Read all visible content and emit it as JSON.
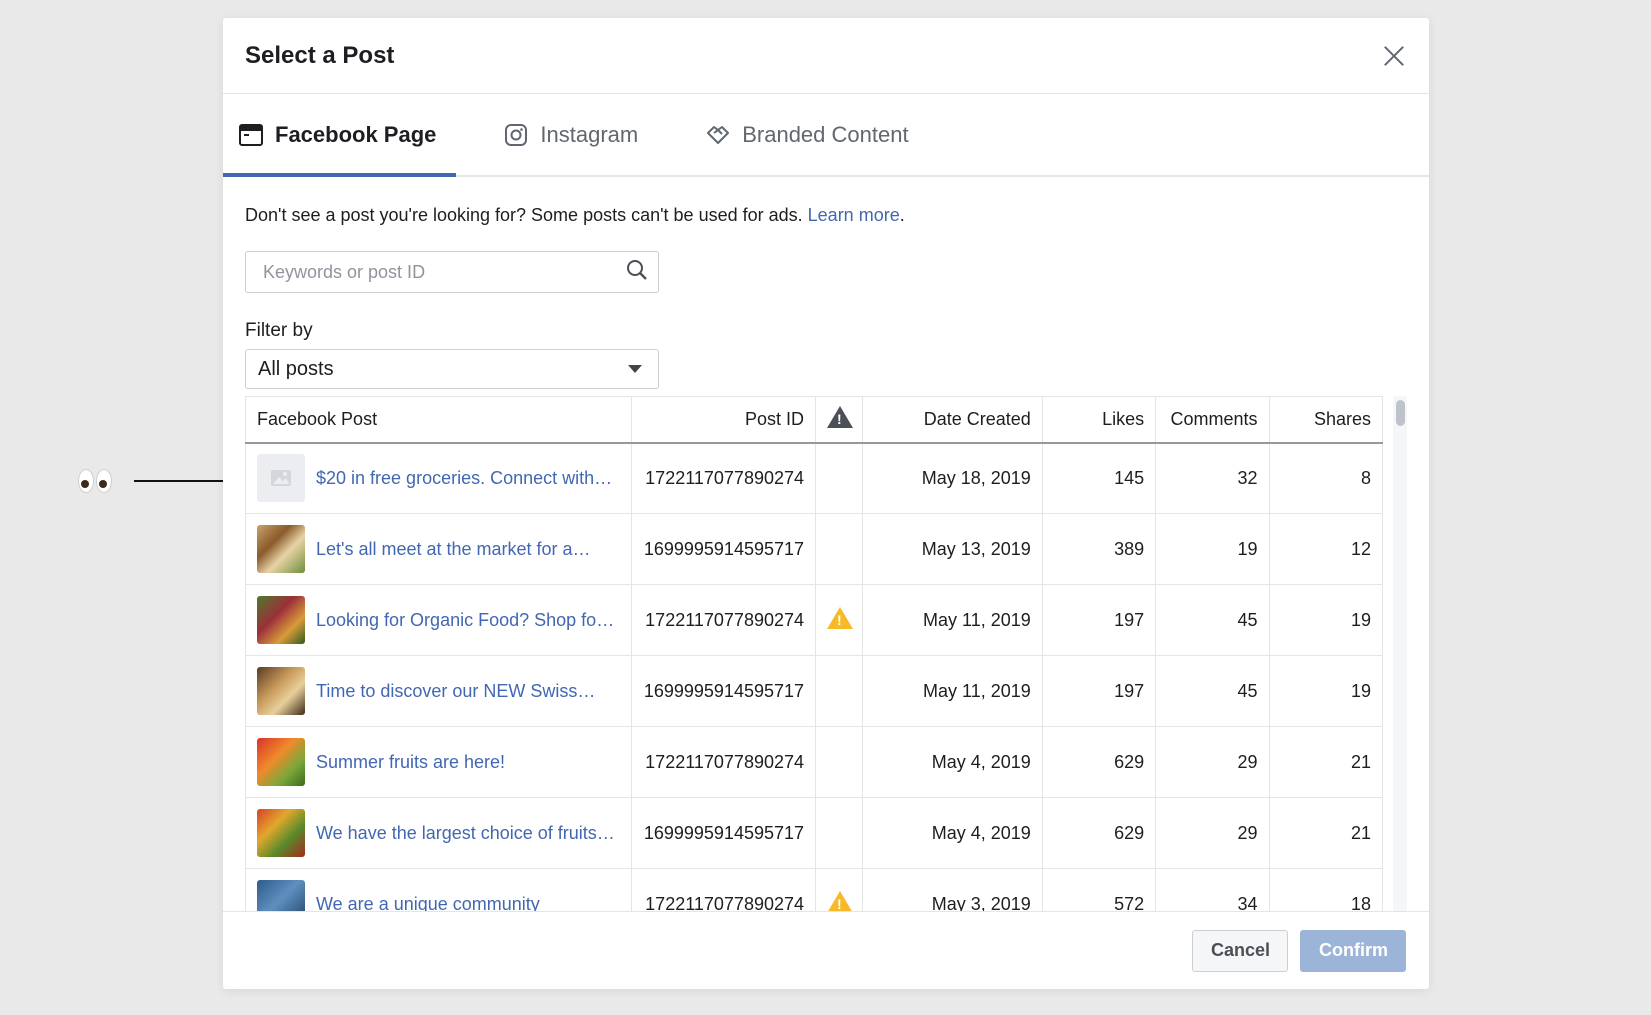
{
  "dialog": {
    "title": "Select a Post",
    "close_icon": "close-icon"
  },
  "tabs": [
    {
      "label": "Facebook Page",
      "icon": "page-icon",
      "active": true
    },
    {
      "label": "Instagram",
      "icon": "instagram-icon",
      "active": false
    },
    {
      "label": "Branded Content",
      "icon": "handshake-icon",
      "active": false
    }
  ],
  "notice": {
    "text": "Don't see a post you're looking for? Some posts can't be used for ads.",
    "link": "Learn more",
    "period": "."
  },
  "search": {
    "placeholder": "Keywords or post ID",
    "icon": "search-icon"
  },
  "filter": {
    "label": "Filter by",
    "selected": "All posts"
  },
  "table": {
    "columns": [
      "Facebook Post",
      "Post ID",
      "warning-icon",
      "Date Created",
      "Likes",
      "Comments",
      "Shares"
    ],
    "rows": [
      {
        "post": "$20 in free groceries. Connect with…",
        "post_id": "1722117077890274",
        "warning": false,
        "date": "May 18, 2019",
        "likes": "145",
        "comments": "32",
        "shares": "8",
        "thumb": "placeholder"
      },
      {
        "post": "Let's all meet at the market for a…",
        "post_id": "1699995914595717",
        "warning": false,
        "date": "May 13, 2019",
        "likes": "389",
        "comments": "19",
        "shares": "12",
        "thumb": "market"
      },
      {
        "post": "Looking for Organic Food? Shop for…",
        "post_id": "1722117077890274",
        "warning": true,
        "date": "May 11, 2019",
        "likes": "197",
        "comments": "45",
        "shares": "19",
        "thumb": "organic"
      },
      {
        "post": "Time to discover our NEW Swiss…",
        "post_id": "1699995914595717",
        "warning": false,
        "date": "May 11, 2019",
        "likes": "197",
        "comments": "45",
        "shares": "19",
        "thumb": "swiss"
      },
      {
        "post": "Summer fruits are here!",
        "post_id": "1722117077890274",
        "warning": false,
        "date": "May 4, 2019",
        "likes": "629",
        "comments": "29",
        "shares": "21",
        "thumb": "fruits"
      },
      {
        "post": "We have the largest choice of fruits…",
        "post_id": "1699995914595717",
        "warning": false,
        "date": "May 4, 2019",
        "likes": "629",
        "comments": "29",
        "shares": "21",
        "thumb": "choice"
      },
      {
        "post": "We are a unique community",
        "post_id": "1722117077890274",
        "warning": true,
        "date": "May 3, 2019",
        "likes": "572",
        "comments": "34",
        "shares": "18",
        "thumb": "community"
      }
    ]
  },
  "footer": {
    "cancel": "Cancel",
    "confirm": "Confirm"
  },
  "colors": {
    "accent": "#4267b2",
    "warning": "#f7b928",
    "confirm_disabled": "#9cb4d8"
  }
}
